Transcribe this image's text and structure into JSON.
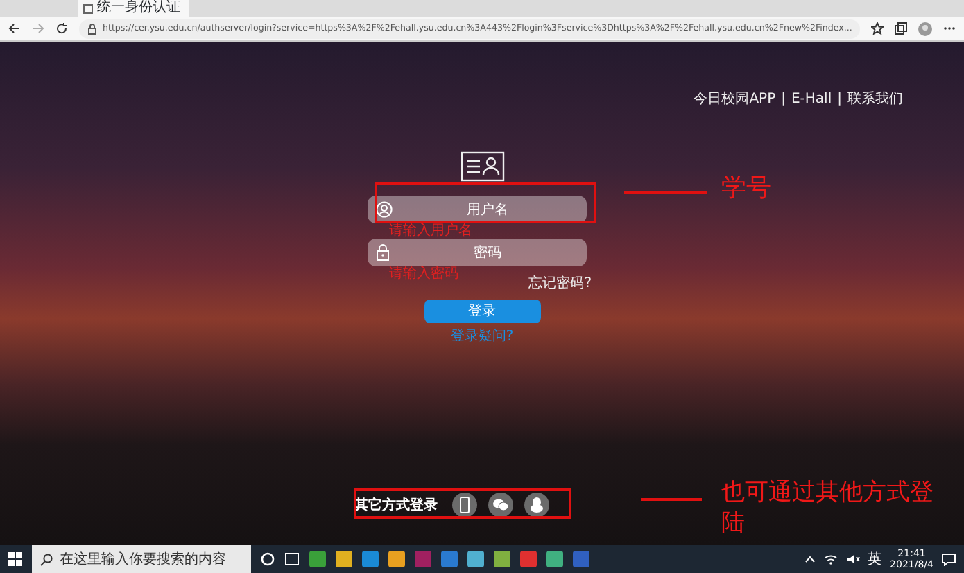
{
  "browser": {
    "tab_title": "统一身份认证",
    "url": "https://cer.ysu.edu.cn/authserver/login?service=https%3A%2F%2Fehall.ysu.edu.cn%3A443%2Flogin%3Fservice%3Dhttps%3A%2F%2Fehall.ysu.edu.cn%2Fnew%2Findex..."
  },
  "top_links": [
    {
      "label": "今日校园APP",
      "separator": "|"
    },
    {
      "label": "E-Hall",
      "separator": "|"
    },
    {
      "label": "联系我们"
    }
  ],
  "login": {
    "username": {
      "placeholder": "用户名",
      "error": "请输入用户名"
    },
    "password": {
      "placeholder": "密码",
      "error": "请输入密码"
    },
    "forgot": "忘记密码?",
    "submit": "登录",
    "help": "登录疑问?"
  },
  "other_login": {
    "label": "其它方式登录"
  },
  "annotations": [
    {
      "text": "学号"
    },
    {
      "text": "也可通过其他方式登陆"
    }
  ],
  "taskbar": {
    "search_placeholder": "在这里输入你要搜索的内容",
    "ime": "英",
    "time": "21:41",
    "date": "2021/8/4"
  }
}
